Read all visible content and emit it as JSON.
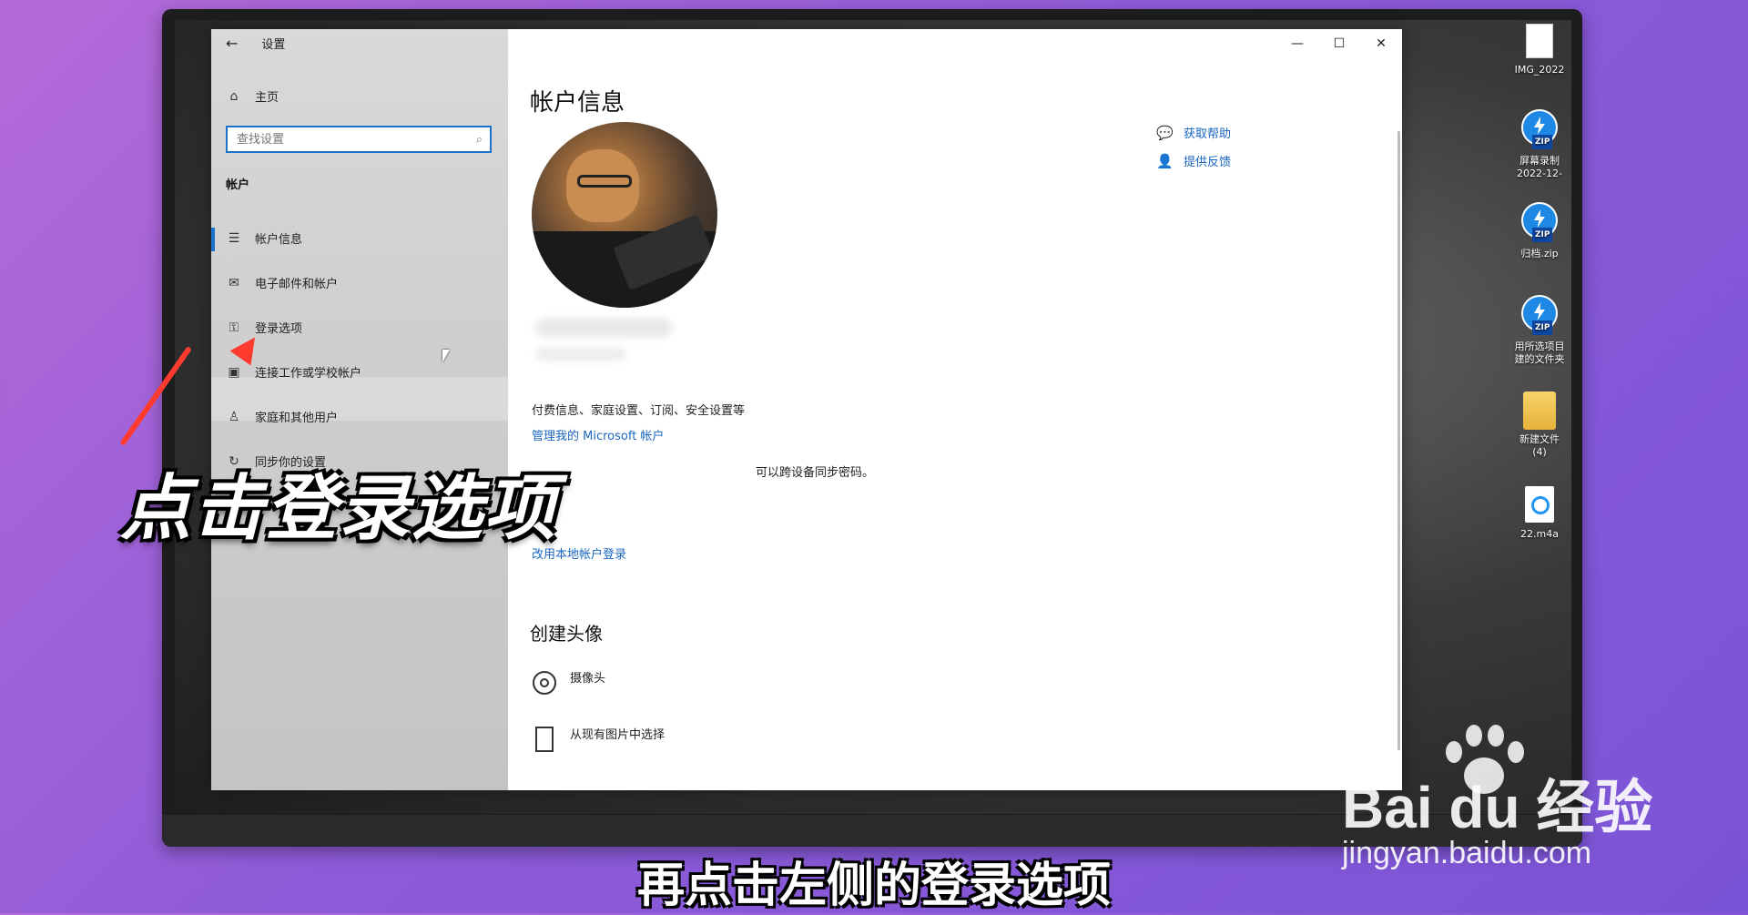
{
  "window": {
    "title": "设置"
  },
  "sidebar": {
    "home_label": "主页",
    "search_placeholder": "查找设置",
    "section_title": "帐户",
    "items": [
      {
        "label": "帐户信息",
        "icon": "account-info-icon"
      },
      {
        "label": "电子邮件和帐户",
        "icon": "mail-icon"
      },
      {
        "label": "登录选项",
        "icon": "key-icon"
      },
      {
        "label": "连接工作或学校帐户",
        "icon": "briefcase-icon"
      },
      {
        "label": "家庭和其他用户",
        "icon": "person-icon"
      },
      {
        "label": "同步你的设置",
        "icon": "sync-icon"
      }
    ]
  },
  "main": {
    "title": "帐户信息",
    "help_label": "获取帮助",
    "feedback_label": "提供反馈",
    "billing_text": "付费信息、家庭设置、订阅、安全设置等",
    "manage_link": "管理我的 Microsoft 帐户",
    "sync_password_text": "可以跨设备同步密码。",
    "local_account_link": "改用本地帐户登录",
    "create_avatar_title": "创建头像",
    "options": [
      {
        "label": "摄像头",
        "icon": "camera-icon"
      },
      {
        "label": "从现有图片中选择",
        "icon": "image-file-icon"
      }
    ]
  },
  "desktop_icons": [
    {
      "label": "IMG_2022"
    },
    {
      "label": "屏幕录制",
      "sublabel": "2022-12-"
    },
    {
      "label": "归档.zip"
    },
    {
      "label": "用所选项目",
      "sublabel": "建的文件夹"
    },
    {
      "label": "新建文件",
      "sublabel": "(4)"
    },
    {
      "label": "22.m4a"
    }
  ],
  "overlay": {
    "caption": "点击登录选项",
    "subtitle": "再点击左侧的登录选项",
    "watermark_main": "Bai du 经验",
    "watermark_sub": "jingyan.baidu.com"
  },
  "colors": {
    "accent": "#1a73c8",
    "link": "#1a66c2",
    "arrow": "#ff3b30"
  }
}
